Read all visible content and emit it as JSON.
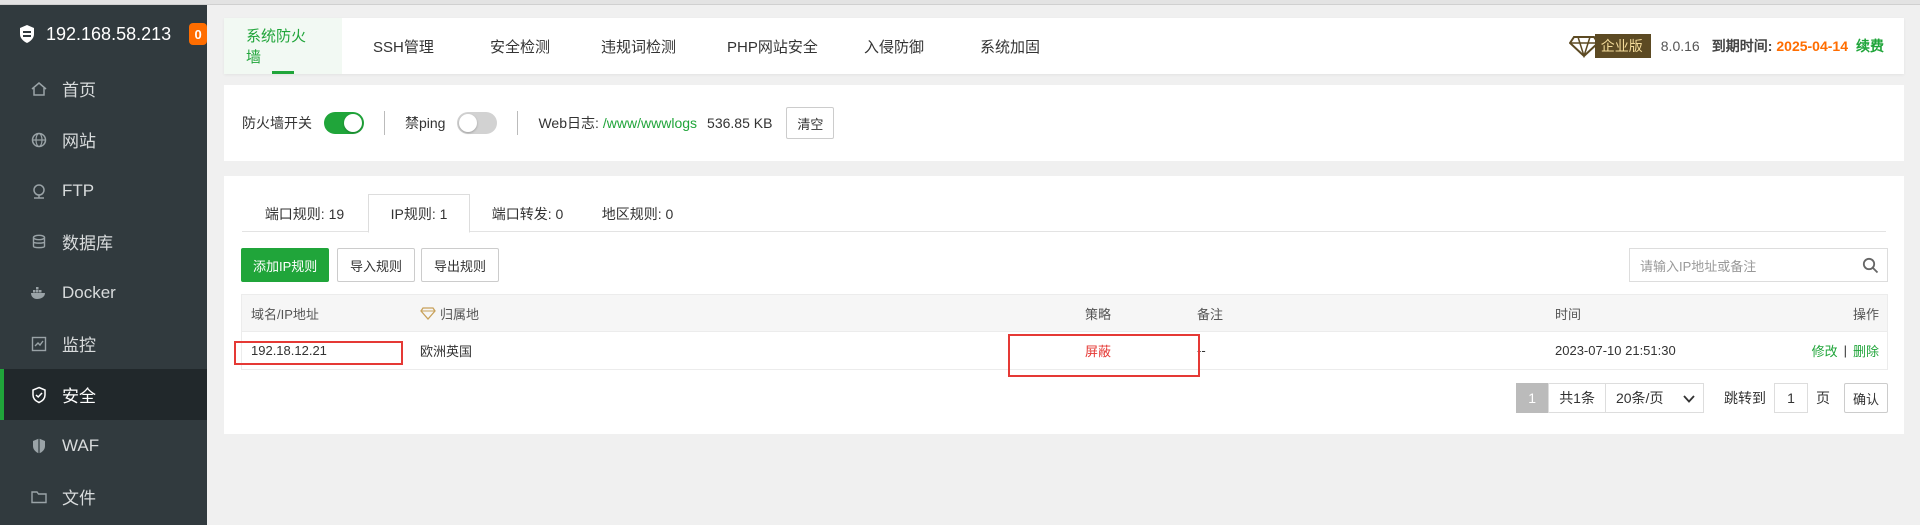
{
  "sidebar": {
    "host": "192.168.58.213",
    "badge": "0",
    "items": [
      {
        "label": "首页",
        "icon": "home-icon"
      },
      {
        "label": "网站",
        "icon": "globe-icon"
      },
      {
        "label": "FTP",
        "icon": "ftp-icon"
      },
      {
        "label": "数据库",
        "icon": "database-icon"
      },
      {
        "label": "Docker",
        "icon": "docker-icon"
      },
      {
        "label": "监控",
        "icon": "monitor-icon"
      },
      {
        "label": "安全",
        "icon": "shield-check-icon",
        "active": true
      },
      {
        "label": "WAF",
        "icon": "waf-shield-icon"
      },
      {
        "label": "文件",
        "icon": "folder-icon"
      }
    ]
  },
  "nav": {
    "tabs": [
      "系统防火墙",
      "SSH管理",
      "安全检测",
      "违规词检测",
      "PHP网站安全",
      "入侵防御",
      "系统加固"
    ],
    "active_tab": 0,
    "edition": "企业版",
    "version": "8.0.16",
    "expire_label": "到期时间:",
    "expire_date": "2025-04-14",
    "renew": "续费"
  },
  "firewall": {
    "switch_label": "防火墙开关",
    "switch_on": true,
    "ping_label": "禁ping",
    "ping_on": false,
    "log_label": "Web日志:",
    "log_path": "/www/wwwlogs",
    "log_size": "536.85 KB",
    "clear_label": "清空"
  },
  "rules": {
    "tabs": [
      "端口规则: 19",
      "IP规则: 1",
      "端口转发: 0",
      "地区规则: 0"
    ],
    "active_tab": 1,
    "add_label": "添加IP规则",
    "import_label": "导入规则",
    "export_label": "导出规则",
    "search_placeholder": "请输入IP地址或备注",
    "columns": {
      "ip": "域名/IP地址",
      "location": "归属地",
      "policy": "策略",
      "note": "备注",
      "time": "时间",
      "action": "操作"
    },
    "rows": [
      {
        "ip": "192.18.12.21",
        "location": "欧洲英国",
        "policy": "屏蔽",
        "note": "--",
        "time": "2023-07-10 21:51:30",
        "edit": "修改",
        "sep": "|",
        "delete": "删除"
      }
    ]
  },
  "pager": {
    "current": "1",
    "total": "共1条",
    "per_page": "20条/页",
    "jump_label": "跳转到",
    "jump_value": "1",
    "page_unit": "页",
    "confirm": "确认"
  },
  "colors": {
    "accent": "#20a53a",
    "sidebar": "#313a3e",
    "danger": "#e53935",
    "warn": "#ff6d00"
  }
}
